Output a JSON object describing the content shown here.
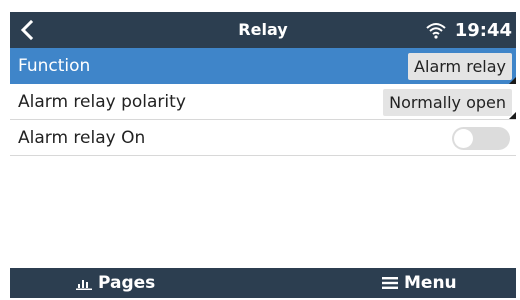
{
  "header": {
    "title": "Relay",
    "time": "19:44",
    "back_icon": "chevron-left-icon",
    "wifi_icon": "wifi-icon"
  },
  "rows": [
    {
      "label": "Function",
      "value": "Alarm relay",
      "selected": true
    },
    {
      "label": "Alarm relay polarity",
      "value": "Normally open",
      "selected": false
    },
    {
      "label": "Alarm relay On",
      "toggle_on": false,
      "selected": false
    }
  ],
  "footer": {
    "pages_label": "Pages",
    "menu_label": "Menu",
    "pages_icon": "bar-chart-icon",
    "menu_icon": "hamburger-menu-icon"
  },
  "colors": {
    "header_bg": "#2c3e50",
    "selected_row_bg": "#3f85c9",
    "value_box_bg": "#e4e4e4"
  }
}
